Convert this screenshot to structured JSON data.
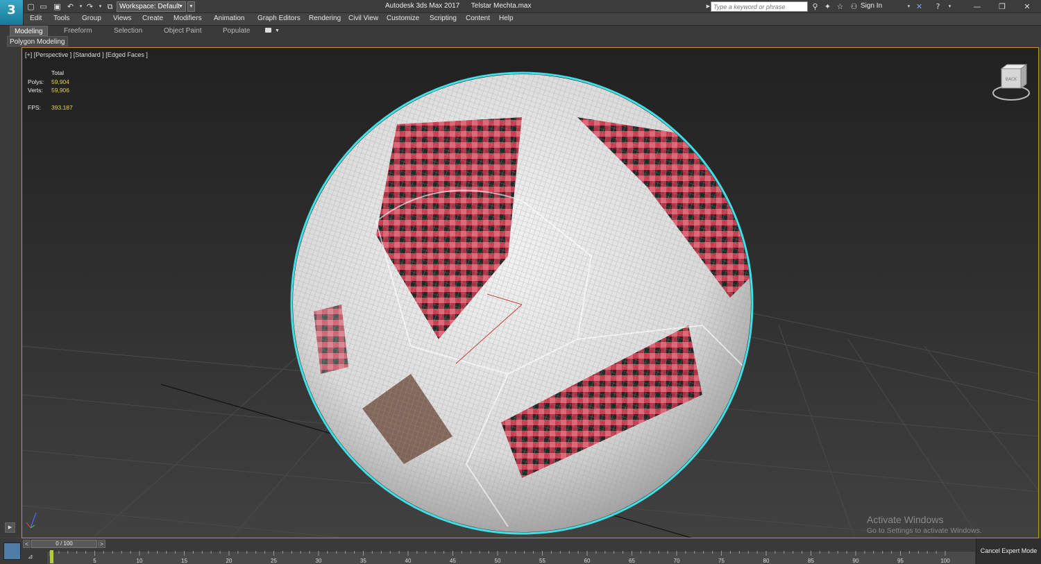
{
  "app": {
    "logo_text": "3",
    "workspace": "Workspace: Default",
    "window_title": "Autodesk 3ds Max 2017      Telstar Mechta.max",
    "search_placeholder": "Type a keyword or phrase",
    "sign_in": "Sign In"
  },
  "menus": [
    "Edit",
    "Tools",
    "Group",
    "Views",
    "Create",
    "Modifiers",
    "Animation",
    "Graph Editors",
    "Rendering",
    "Civil View",
    "Customize",
    "Scripting",
    "Content",
    "Help"
  ],
  "ribbon": {
    "tabs": [
      "Modeling",
      "Freeform",
      "Selection",
      "Object Paint",
      "Populate"
    ],
    "active_tab": "Modeling",
    "panel_label": "Polygon Modeling"
  },
  "viewport": {
    "label": "[+] [Perspective ] [Standard ] [Edged Faces ]",
    "stats": {
      "header": "Total",
      "polys_label": "Polys:",
      "polys": "59,904",
      "verts_label": "Verts:",
      "verts": "59,906",
      "fps_label": "FPS:",
      "fps": "393.187"
    },
    "viewcube_label": "BACK"
  },
  "watermark": {
    "title": "Activate Windows",
    "subtitle": "Go to Settings to activate Windows."
  },
  "timeline": {
    "frame": "0 / 100",
    "ticks": [
      "5",
      "10",
      "15",
      "20",
      "25",
      "30",
      "35",
      "40",
      "45",
      "50",
      "55",
      "60",
      "65",
      "70",
      "75",
      "80",
      "85",
      "90",
      "95",
      "100"
    ],
    "cancel_expert_mode": "Cancel Expert Mode"
  },
  "colors": {
    "viewport_border": "#b89a1e",
    "stats_value": "#e5d060",
    "selection_outline": "#3fe0e6",
    "ball_red": "#c8354a",
    "logo_blue": "#2a92b3"
  }
}
